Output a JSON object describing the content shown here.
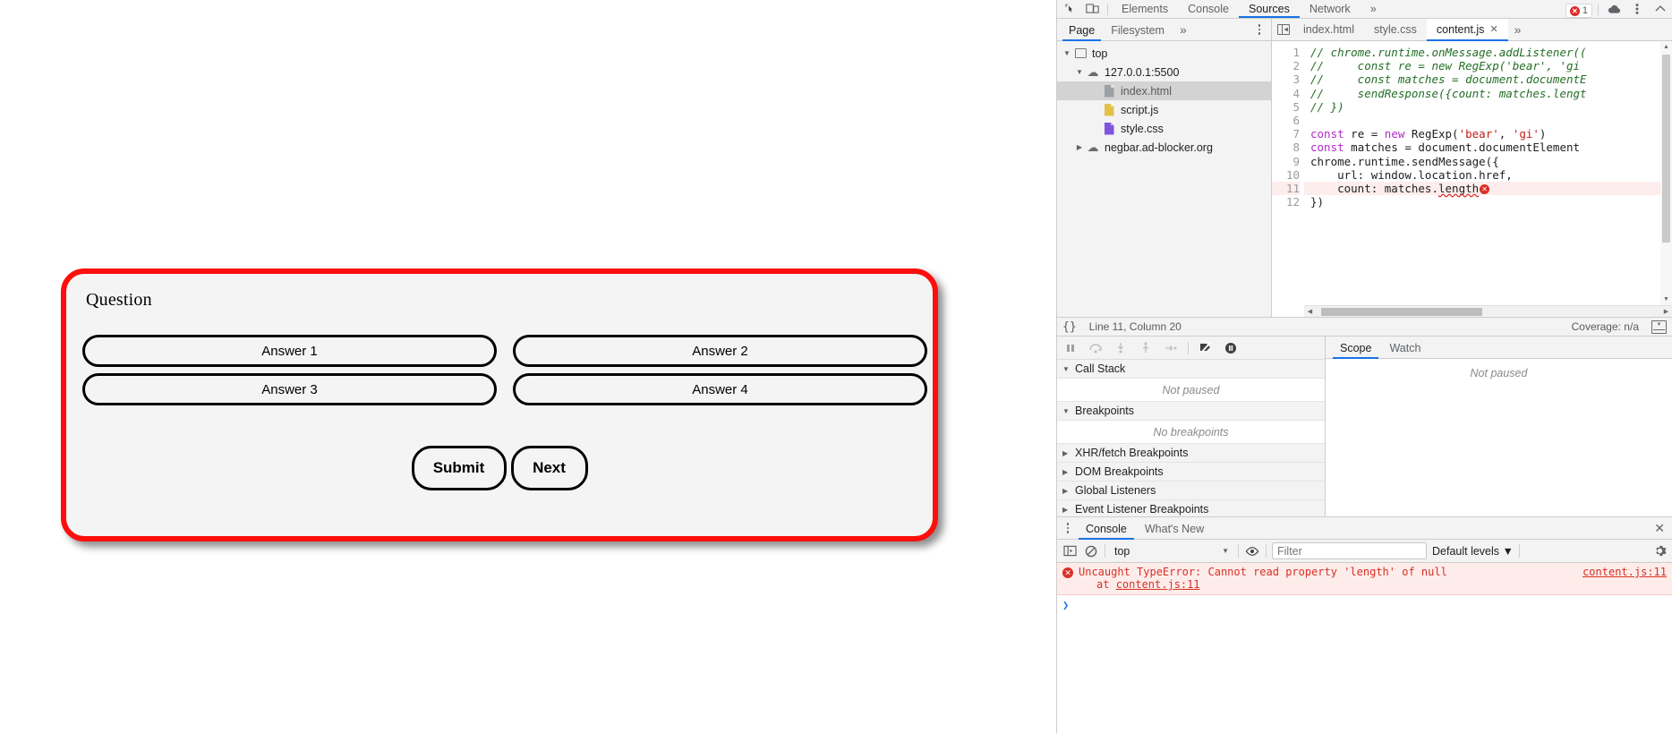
{
  "quiz": {
    "question": "Question",
    "answers": [
      "Answer 1",
      "Answer 2",
      "Answer 3",
      "Answer 4"
    ],
    "submit_label": "Submit",
    "next_label": "Next",
    "border_color": "#fc0f0c",
    "background_color": "#f4f4f4"
  },
  "devtools": {
    "main_tabs": [
      {
        "label": "Elements",
        "active": false
      },
      {
        "label": "Console",
        "active": false
      },
      {
        "label": "Sources",
        "active": true
      },
      {
        "label": "Network",
        "active": false
      }
    ],
    "main_tabs_more": "»",
    "error_badge_count": "1",
    "accent_color": "#1a73e8",
    "navigator": {
      "tabs": [
        {
          "label": "Page",
          "active": true
        },
        {
          "label": "Filesystem",
          "active": false
        }
      ],
      "more": "»",
      "tree": [
        {
          "label": "top",
          "icon": "frame-icon",
          "twisty": "▼",
          "indent": 0,
          "selected": false
        },
        {
          "label": "127.0.0.1:5500",
          "icon": "cloud-icon",
          "twisty": "▼",
          "indent": 1,
          "selected": false
        },
        {
          "label": "index.html",
          "icon": "html-file-icon",
          "twisty": "",
          "indent": 2,
          "selected": true
        },
        {
          "label": "script.js",
          "icon": "js-file-icon",
          "twisty": "",
          "indent": 2,
          "selected": false
        },
        {
          "label": "style.css",
          "icon": "css-file-icon",
          "twisty": "",
          "indent": 2,
          "selected": false
        },
        {
          "label": "negbar.ad-blocker.org",
          "icon": "cloud-icon",
          "twisty": "▶",
          "indent": 1,
          "selected": false
        }
      ]
    },
    "editor": {
      "tabs": [
        {
          "label": "index.html",
          "active": false,
          "closable": false
        },
        {
          "label": "style.css",
          "active": false,
          "closable": false
        },
        {
          "label": "content.js",
          "active": true,
          "closable": true
        }
      ],
      "more": "»",
      "close_glyph": "✕",
      "lines": [
        {
          "n": "1",
          "tokens": [
            {
              "t": "comment",
              "v": "// chrome.runtime.onMessage.addListener(("
            }
          ]
        },
        {
          "n": "2",
          "tokens": [
            {
              "t": "comment",
              "v": "//     const re = new RegExp('bear', 'gi"
            }
          ]
        },
        {
          "n": "3",
          "tokens": [
            {
              "t": "comment",
              "v": "//     const matches = document.documentE"
            }
          ]
        },
        {
          "n": "4",
          "tokens": [
            {
              "t": "comment",
              "v": "//     sendResponse({count: matches.lengt"
            }
          ]
        },
        {
          "n": "5",
          "tokens": [
            {
              "t": "comment",
              "v": "// })"
            }
          ]
        },
        {
          "n": "6",
          "tokens": []
        },
        {
          "n": "7",
          "tokens": [
            {
              "t": "keyword",
              "v": "const"
            },
            {
              "t": "plain",
              "v": " re = "
            },
            {
              "t": "keyword",
              "v": "new"
            },
            {
              "t": "plain",
              "v": " RegExp("
            },
            {
              "t": "string",
              "v": "'bear'"
            },
            {
              "t": "plain",
              "v": ", "
            },
            {
              "t": "string",
              "v": "'gi'"
            },
            {
              "t": "plain",
              "v": ")"
            }
          ]
        },
        {
          "n": "8",
          "tokens": [
            {
              "t": "keyword",
              "v": "const"
            },
            {
              "t": "plain",
              "v": " matches = document.documentElement"
            }
          ]
        },
        {
          "n": "9",
          "tokens": [
            {
              "t": "plain",
              "v": "chrome.runtime.sendMessage({"
            }
          ]
        },
        {
          "n": "10",
          "tokens": [
            {
              "t": "plain",
              "v": "    url: window.location.href,"
            }
          ]
        },
        {
          "n": "11",
          "error": true,
          "tokens": [
            {
              "t": "plain",
              "v": "    count: matches."
            },
            {
              "t": "squiggle",
              "v": "length"
            },
            {
              "t": "errmark",
              "v": "✕"
            }
          ]
        },
        {
          "n": "12",
          "tokens": [
            {
              "t": "plain",
              "v": "})"
            }
          ]
        }
      ]
    },
    "status_bar": {
      "braces": "{}",
      "position": "Line 11, Column 20",
      "coverage": "Coverage: n/a"
    },
    "debugger": {
      "toolbar_icons": [
        "pause-icon",
        "step-over-icon",
        "step-into-icon",
        "step-out-icon",
        "step-icon",
        "deactivate-breakpoints-icon",
        "pause-on-exceptions-icon"
      ],
      "sections": [
        {
          "label": "Call Stack",
          "twisty": "▼",
          "empty": "Not paused"
        },
        {
          "label": "Breakpoints",
          "twisty": "▼",
          "empty": "No breakpoints"
        },
        {
          "label": "XHR/fetch Breakpoints",
          "twisty": "▶",
          "empty": null
        },
        {
          "label": "DOM Breakpoints",
          "twisty": "▶",
          "empty": null
        },
        {
          "label": "Global Listeners",
          "twisty": "▶",
          "empty": null
        },
        {
          "label": "Event Listener Breakpoints",
          "twisty": "▶",
          "empty": null
        }
      ],
      "scope_tabs": [
        {
          "label": "Scope",
          "active": true
        },
        {
          "label": "Watch",
          "active": false
        }
      ],
      "scope_empty": "Not paused"
    },
    "drawer": {
      "tabs": [
        {
          "label": "Console",
          "active": true
        },
        {
          "label": "What's New",
          "active": false
        }
      ],
      "close_glyph": "✕",
      "toolbar": {
        "sidebar_icon": "console-sidebar-icon",
        "clear_icon": "clear-console-icon",
        "context": "top",
        "eye_icon": "live-expression-icon",
        "filter_placeholder": "Filter",
        "levels": "Default levels ▼",
        "settings_icon": "gear-icon"
      },
      "messages": [
        {
          "type": "error",
          "text": "Uncaught TypeError: Cannot read property 'length' of null",
          "stack": "at content.js:11",
          "stack_link": "content.js:11",
          "source": "content.js:11"
        }
      ],
      "prompt_glyph": "❯"
    }
  }
}
